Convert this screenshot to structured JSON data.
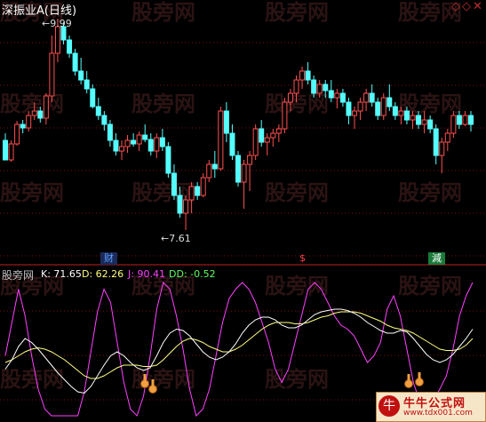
{
  "header": {
    "title": "深振业A(日线)",
    "nav_icons": [
      "diamond-left-icon",
      "diamond-right-icon",
      "close-icon"
    ]
  },
  "price_marks": {
    "high": "9.99",
    "low": "7.61"
  },
  "event_badges": [
    {
      "name": "badge-cai",
      "label": "财",
      "color": "#5fa0ff",
      "bg": "#1a2a5a"
    },
    {
      "name": "badge-dollar",
      "label": "$",
      "color": "#ff4444",
      "bg": "#000000"
    },
    {
      "name": "badge-jian",
      "label": "減",
      "color": "#ffffff",
      "bg": "#1a7a3a"
    }
  ],
  "indicator": {
    "name": "股旁网",
    "k": "K: 71.65",
    "d": "D: 62.26",
    "j": "J: 90.41",
    "dd": "DD: -0.52",
    "colors": {
      "k": "#ffffff",
      "d": "#ffff80",
      "j": "#ff40ff",
      "dd": "#60ff60",
      "name": "#c0c0c0"
    }
  },
  "watermark": {
    "text": "股旁网"
  },
  "footer": {
    "logo_text": "牛牛公式网",
    "url": "www.tdx001.com"
  },
  "colors": {
    "up": "#ff5050",
    "down": "#54ffff",
    "grid": "#7a1010",
    "divider": "#c02020"
  },
  "chart_data": {
    "type": "candlestick",
    "title": "深振业A(日线)",
    "high_mark": 9.99,
    "low_mark": 7.61,
    "candles": [
      [
        8.62,
        8.7,
        8.4,
        8.4
      ],
      [
        8.4,
        8.62,
        8.38,
        8.58
      ],
      [
        8.58,
        8.84,
        8.56,
        8.8
      ],
      [
        8.8,
        8.85,
        8.7,
        8.76
      ],
      [
        8.76,
        8.95,
        8.72,
        8.9
      ],
      [
        8.9,
        9.05,
        8.85,
        8.95
      ],
      [
        8.95,
        9.0,
        8.82,
        8.87
      ],
      [
        8.87,
        9.15,
        8.8,
        9.12
      ],
      [
        9.12,
        9.8,
        9.05,
        9.6
      ],
      [
        9.6,
        9.99,
        9.5,
        9.9
      ],
      [
        9.9,
        9.95,
        9.7,
        9.75
      ],
      [
        9.75,
        9.8,
        9.55,
        9.6
      ],
      [
        9.6,
        9.65,
        9.35,
        9.4
      ],
      [
        9.4,
        9.55,
        9.25,
        9.3
      ],
      [
        9.3,
        9.4,
        9.15,
        9.2
      ],
      [
        9.2,
        9.25,
        8.98,
        9.0
      ],
      [
        9.0,
        9.1,
        8.85,
        8.9
      ],
      [
        8.9,
        8.95,
        8.73,
        8.8
      ],
      [
        8.8,
        8.85,
        8.55,
        8.62
      ],
      [
        8.62,
        8.7,
        8.45,
        8.5
      ],
      [
        8.5,
        8.62,
        8.4,
        8.55
      ],
      [
        8.55,
        8.68,
        8.48,
        8.62
      ],
      [
        8.62,
        8.7,
        8.55,
        8.58
      ],
      [
        8.58,
        8.72,
        8.5,
        8.68
      ],
      [
        8.68,
        8.8,
        8.6,
        8.63
      ],
      [
        8.63,
        8.7,
        8.45,
        8.5
      ],
      [
        8.5,
        8.7,
        8.42,
        8.65
      ],
      [
        8.65,
        8.75,
        8.5,
        8.55
      ],
      [
        8.55,
        8.6,
        8.2,
        8.25
      ],
      [
        8.25,
        8.35,
        7.95,
        8.0
      ],
      [
        8.0,
        8.1,
        7.75,
        7.8
      ],
      [
        7.8,
        8.0,
        7.61,
        7.95
      ],
      [
        7.95,
        8.15,
        7.8,
        8.1
      ],
      [
        8.1,
        8.15,
        7.95,
        8.0
      ],
      [
        8.0,
        8.25,
        7.98,
        8.2
      ],
      [
        8.2,
        8.4,
        8.15,
        8.35
      ],
      [
        8.35,
        8.5,
        8.2,
        8.3
      ],
      [
        8.3,
        9.0,
        8.28,
        8.95
      ],
      [
        8.95,
        9.05,
        8.6,
        8.7
      ],
      [
        8.7,
        8.8,
        8.4,
        8.45
      ],
      [
        8.45,
        8.5,
        8.1,
        8.15
      ],
      [
        8.15,
        8.4,
        7.85,
        8.35
      ],
      [
        8.35,
        8.5,
        8.05,
        8.45
      ],
      [
        8.45,
        8.8,
        8.4,
        8.75
      ],
      [
        8.75,
        8.85,
        8.55,
        8.6
      ],
      [
        8.6,
        8.7,
        8.45,
        8.65
      ],
      [
        8.65,
        8.75,
        8.55,
        8.7
      ],
      [
        8.7,
        8.8,
        8.6,
        8.75
      ],
      [
        8.75,
        9.1,
        8.7,
        9.05
      ],
      [
        9.05,
        9.2,
        8.95,
        9.15
      ],
      [
        9.15,
        9.35,
        9.05,
        9.3
      ],
      [
        9.3,
        9.45,
        9.2,
        9.4
      ],
      [
        9.4,
        9.5,
        9.25,
        9.3
      ],
      [
        9.3,
        9.35,
        9.1,
        9.15
      ],
      [
        9.15,
        9.3,
        9.1,
        9.25
      ],
      [
        9.25,
        9.3,
        9.1,
        9.18
      ],
      [
        9.18,
        9.3,
        9.05,
        9.1
      ],
      [
        9.1,
        9.2,
        8.98,
        9.15
      ],
      [
        9.15,
        9.2,
        9.0,
        9.05
      ],
      [
        9.05,
        9.1,
        8.8,
        8.9
      ],
      [
        8.9,
        9.0,
        8.75,
        8.95
      ],
      [
        8.95,
        9.1,
        8.85,
        9.05
      ],
      [
        9.05,
        9.2,
        8.95,
        9.15
      ],
      [
        9.15,
        9.25,
        9.0,
        9.05
      ],
      [
        9.05,
        9.1,
        8.85,
        8.9
      ],
      [
        8.9,
        9.15,
        8.85,
        9.1
      ],
      [
        9.1,
        9.25,
        8.95,
        9.0
      ],
      [
        9.0,
        9.05,
        8.85,
        8.9
      ],
      [
        8.9,
        9.0,
        8.8,
        8.95
      ],
      [
        8.95,
        9.0,
        8.8,
        8.85
      ],
      [
        8.85,
        8.95,
        8.75,
        8.9
      ],
      [
        8.9,
        8.95,
        8.75,
        8.8
      ],
      [
        8.8,
        8.95,
        8.7,
        8.85
      ],
      [
        8.85,
        8.9,
        8.7,
        8.75
      ],
      [
        8.75,
        8.8,
        8.35,
        8.45
      ],
      [
        8.45,
        8.65,
        8.25,
        8.6
      ],
      [
        8.6,
        8.75,
        8.5,
        8.7
      ],
      [
        8.7,
        8.95,
        8.65,
        8.9
      ],
      [
        8.9,
        8.95,
        8.75,
        8.8
      ],
      [
        8.8,
        8.95,
        8.78,
        8.9
      ],
      [
        8.9,
        8.95,
        8.72,
        8.8
      ]
    ],
    "kdj": {
      "j": [
        45,
        70,
        95,
        75,
        45,
        20,
        5,
        0,
        0,
        0,
        0,
        0,
        18,
        48,
        78,
        95,
        85,
        55,
        25,
        5,
        0,
        15,
        45,
        80,
        100,
        95,
        75,
        50,
        20,
        0,
        5,
        20,
        45,
        70,
        88,
        95,
        100,
        95,
        85,
        70,
        55,
        35,
        25,
        35,
        55,
        75,
        95,
        100,
        95,
        85,
        75,
        68,
        65,
        60,
        50,
        40,
        45,
        55,
        80,
        90,
        75,
        50,
        25,
        10,
        5,
        12,
        20,
        30,
        50,
        75,
        90,
        100
      ],
      "k": [
        35,
        42,
        52,
        58,
        55,
        50,
        44,
        38,
        32,
        27,
        22,
        18,
        17,
        22,
        30,
        38,
        45,
        48,
        45,
        40,
        36,
        34,
        36,
        45,
        55,
        62,
        65,
        64,
        60,
        54,
        48,
        44,
        42,
        44,
        48,
        54,
        62,
        68,
        72,
        74,
        74,
        72,
        68,
        66,
        66,
        68,
        72,
        76,
        78,
        79,
        80,
        80,
        79,
        77,
        74,
        70,
        67,
        64,
        62,
        62,
        64,
        63,
        58,
        52,
        46,
        42,
        40,
        42,
        46,
        52,
        58,
        65
      ],
      "d": [
        40,
        42,
        45,
        48,
        50,
        51,
        50,
        48,
        45,
        42,
        38,
        34,
        30,
        28,
        28,
        30,
        33,
        36,
        38,
        38,
        38,
        37,
        37,
        38,
        42,
        47,
        52,
        56,
        58,
        57,
        55,
        52,
        50,
        48,
        48,
        50,
        53,
        57,
        61,
        65,
        68,
        70,
        70,
        70,
        69,
        69,
        70,
        72,
        74,
        75,
        77,
        78,
        78,
        78,
        77,
        75,
        73,
        71,
        68,
        66,
        65,
        64,
        62,
        59,
        56,
        53,
        50,
        49,
        49,
        50,
        53,
        58
      ]
    }
  }
}
